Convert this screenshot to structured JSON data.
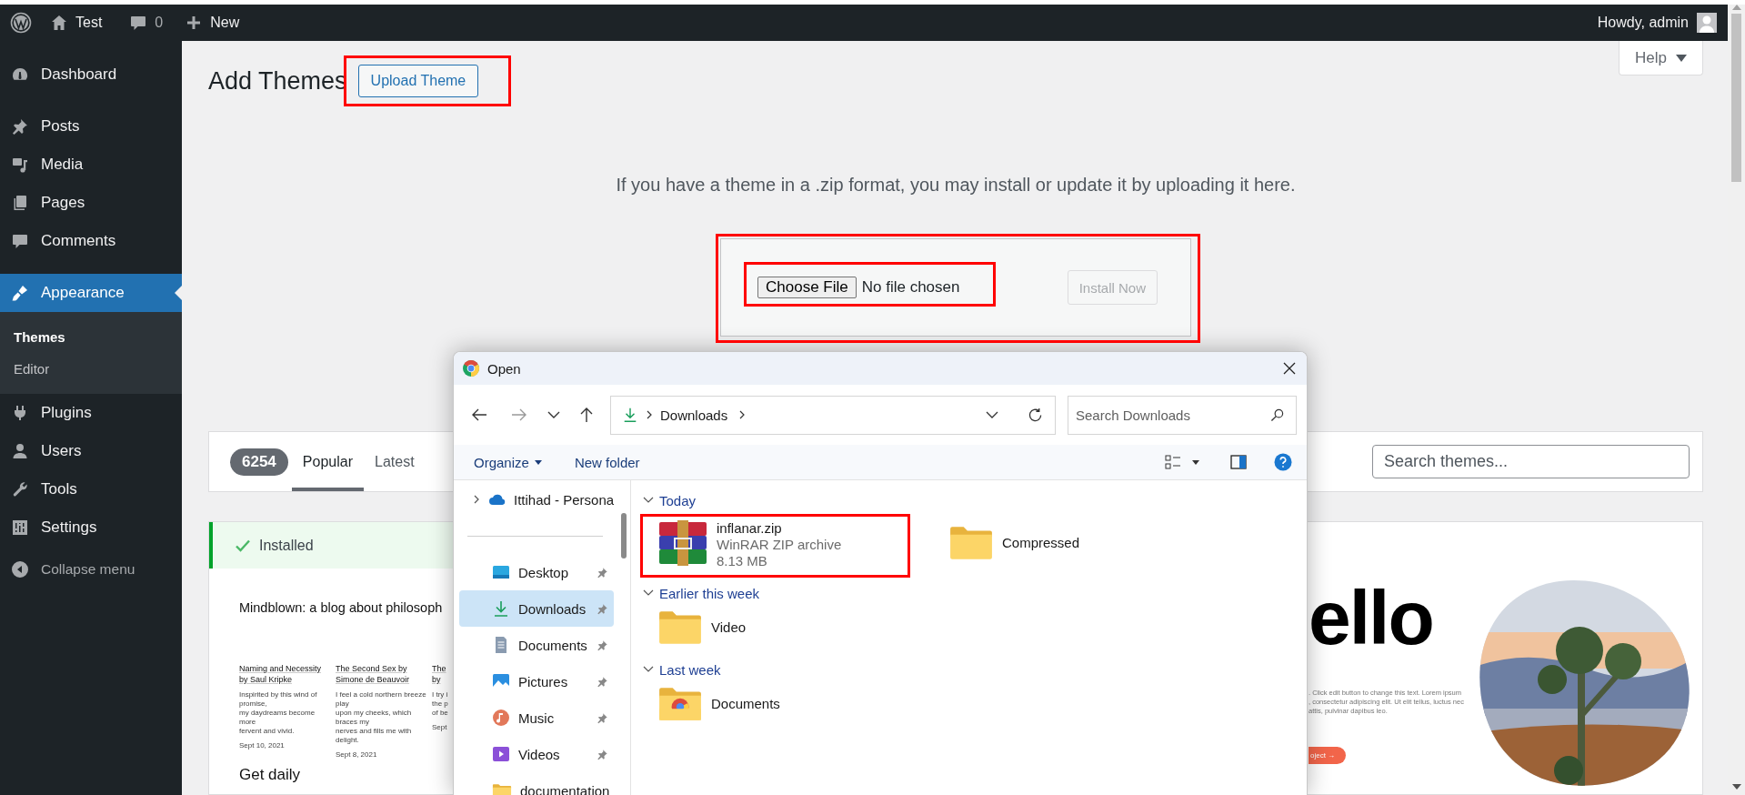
{
  "admin_bar": {
    "site": "Test",
    "comments": "0",
    "new": "New",
    "greeting": "Howdy, admin"
  },
  "sidebar": {
    "groups": [
      [
        {
          "label": "Dashboard",
          "selected": false
        }
      ],
      [
        {
          "label": "Posts",
          "selected": false
        },
        {
          "label": "Media",
          "selected": false
        },
        {
          "label": "Pages",
          "selected": false
        },
        {
          "label": "Comments",
          "selected": false
        }
      ],
      [
        {
          "label": "Appearance",
          "selected": true,
          "children": [
            {
              "label": "Themes",
              "selected": true
            },
            {
              "label": "Editor",
              "selected": false
            }
          ]
        },
        {
          "label": "Plugins",
          "selected": false
        },
        {
          "label": "Users",
          "selected": false
        },
        {
          "label": "Tools",
          "selected": false
        },
        {
          "label": "Settings",
          "selected": false
        }
      ]
    ],
    "collapse": "Collapse menu"
  },
  "page": {
    "title": "Add Themes",
    "upload_button": "Upload Theme",
    "help": "Help",
    "description": "If you have a theme in a .zip format, you may install or update it by uploading it here.",
    "upload_form": {
      "choose_button": "Choose File",
      "file_status": "No file chosen",
      "install_button": "Install Now",
      "install_disabled": true
    }
  },
  "filter_bar": {
    "count": "6254",
    "tabs": [
      {
        "label": "Popular",
        "selected": true
      },
      {
        "label": "Latest",
        "selected": false
      }
    ],
    "search": {
      "placeholder": "Search themes..."
    }
  },
  "themes": [
    {
      "installed": true,
      "installed_label": "Installed",
      "preview": {
        "kind": "blog",
        "heading": "Mindblown: a blog about philosoph",
        "posts": [
          {
            "title_lines": [
              "Naming and Necessity",
              "by Saul Kripke"
            ],
            "excerpt_lines": [
              "Inspirited by this wind of promise,",
              "my daydreams become more",
              "fervent and vivid."
            ],
            "date": "Sept 10, 2021"
          },
          {
            "title_lines": [
              "The Second Sex by",
              "Simone de Beauvoir"
            ],
            "excerpt_lines": [
              "I feel a cold northern breeze play",
              "upon my cheeks, which braces my",
              "nerves and fills me with delight."
            ],
            "date": "Sept 8, 2021"
          },
          {
            "title_lines": [
              "The",
              "by"
            ],
            "excerpt_lines": [
              "I try i",
              "the p",
              "of be"
            ],
            "date": "Sept"
          }
        ],
        "footer_heading": "Get daily"
      }
    },
    {
      "installed": false,
      "preview": {
        "kind": "portfolio",
        "heading": "ello",
        "body_lines": [
          ". Click edit button to change this text. Lorem ipsum",
          ", consectetur adipiscing elit. Ut elit tellus, luctus nec",
          "attis, pulvinar dapibus leo."
        ],
        "button": "oject →"
      }
    }
  ],
  "dialog": {
    "title": "Open",
    "address": {
      "location": "Downloads"
    },
    "search": {
      "placeholder": "Search Downloads"
    },
    "toolbar": {
      "organize": "Organize",
      "new_folder": "New folder"
    },
    "nav_pane": {
      "items": [
        {
          "kind": "cloud",
          "label": "Ittihad - Persona",
          "selected": false
        },
        {
          "kind": "pinned",
          "label": "Desktop",
          "selected": false
        },
        {
          "kind": "pinned",
          "label": "Downloads",
          "selected": true
        },
        {
          "kind": "pinned",
          "label": "Documents",
          "selected": false
        },
        {
          "kind": "pinned",
          "label": "Pictures",
          "selected": false
        },
        {
          "kind": "pinned",
          "label": "Music",
          "selected": false
        },
        {
          "kind": "pinned",
          "label": "Videos",
          "selected": false
        },
        {
          "kind": "folder",
          "label": "documentation",
          "selected": false
        }
      ]
    },
    "groups": [
      {
        "label": "Today",
        "expanded": true,
        "items": [
          {
            "kind": "archive",
            "name": "inflanar.zip",
            "type": "WinRAR ZIP archive",
            "size": "8.13 MB"
          },
          {
            "kind": "folder",
            "name": "Compressed"
          }
        ]
      },
      {
        "label": "Earlier this week",
        "expanded": true,
        "items": [
          {
            "kind": "folder",
            "name": "Video"
          }
        ]
      },
      {
        "label": "Last week",
        "expanded": true,
        "items": [
          {
            "kind": "app-folder",
            "name": "Documents"
          }
        ]
      }
    ]
  }
}
